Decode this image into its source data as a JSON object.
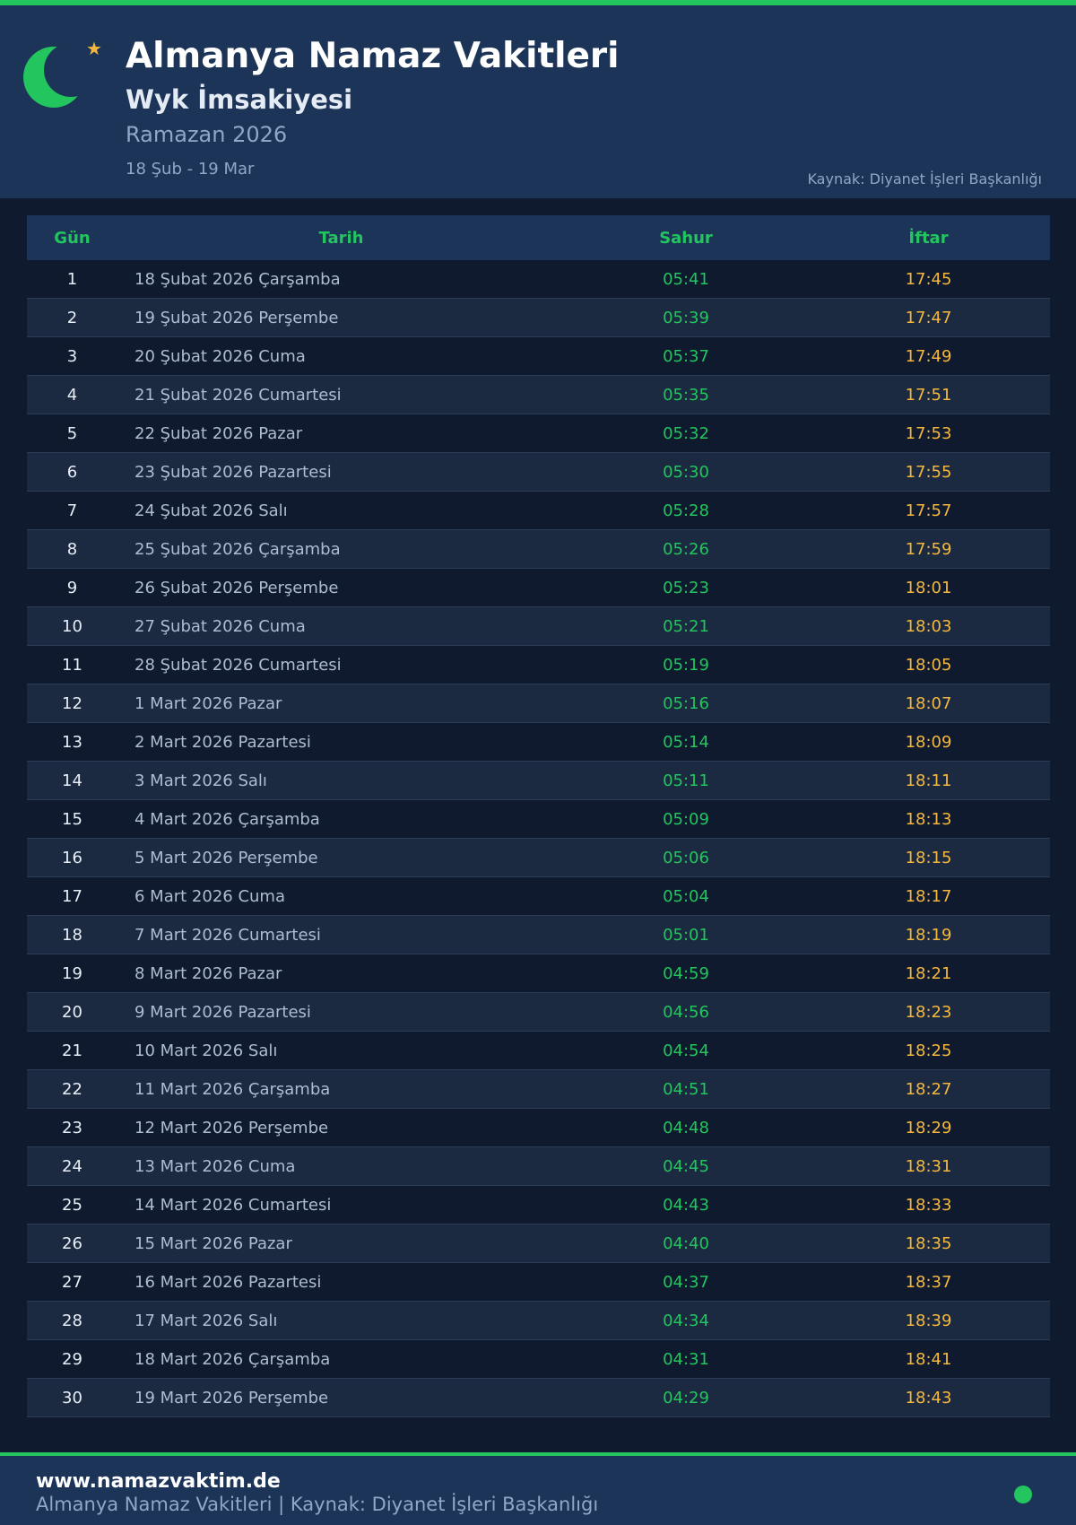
{
  "header": {
    "title": "Almanya Namaz Vakitleri",
    "subtitle": "Wyk İmsakiyesi",
    "ramazan": "Ramazan 2026",
    "date_range": "18 Şub - 19 Mar",
    "source": "Kaynak: Diyanet İşleri Başkanlığı",
    "icons": [
      "crescent-icon",
      "star-icon"
    ]
  },
  "colors": {
    "background": "#0f1a2e",
    "header": "#1c3457",
    "accent_green": "#22c55e",
    "accent_gold": "#f5b83d"
  },
  "table": {
    "columns": [
      "Gün",
      "Tarih",
      "Sahur",
      "İftar"
    ],
    "rows": [
      {
        "gun": "1",
        "tarih": "18 Şubat 2026 Çarşamba",
        "sahur": "05:41",
        "iftar": "17:45"
      },
      {
        "gun": "2",
        "tarih": "19 Şubat 2026 Perşembe",
        "sahur": "05:39",
        "iftar": "17:47"
      },
      {
        "gun": "3",
        "tarih": "20 Şubat 2026 Cuma",
        "sahur": "05:37",
        "iftar": "17:49"
      },
      {
        "gun": "4",
        "tarih": "21 Şubat 2026 Cumartesi",
        "sahur": "05:35",
        "iftar": "17:51"
      },
      {
        "gun": "5",
        "tarih": "22 Şubat 2026 Pazar",
        "sahur": "05:32",
        "iftar": "17:53"
      },
      {
        "gun": "6",
        "tarih": "23 Şubat 2026 Pazartesi",
        "sahur": "05:30",
        "iftar": "17:55"
      },
      {
        "gun": "7",
        "tarih": "24 Şubat 2026 Salı",
        "sahur": "05:28",
        "iftar": "17:57"
      },
      {
        "gun": "8",
        "tarih": "25 Şubat 2026 Çarşamba",
        "sahur": "05:26",
        "iftar": "17:59"
      },
      {
        "gun": "9",
        "tarih": "26 Şubat 2026 Perşembe",
        "sahur": "05:23",
        "iftar": "18:01"
      },
      {
        "gun": "10",
        "tarih": "27 Şubat 2026 Cuma",
        "sahur": "05:21",
        "iftar": "18:03"
      },
      {
        "gun": "11",
        "tarih": "28 Şubat 2026 Cumartesi",
        "sahur": "05:19",
        "iftar": "18:05"
      },
      {
        "gun": "12",
        "tarih": "1 Mart 2026 Pazar",
        "sahur": "05:16",
        "iftar": "18:07"
      },
      {
        "gun": "13",
        "tarih": "2 Mart 2026 Pazartesi",
        "sahur": "05:14",
        "iftar": "18:09"
      },
      {
        "gun": "14",
        "tarih": "3 Mart 2026 Salı",
        "sahur": "05:11",
        "iftar": "18:11"
      },
      {
        "gun": "15",
        "tarih": "4 Mart 2026 Çarşamba",
        "sahur": "05:09",
        "iftar": "18:13"
      },
      {
        "gun": "16",
        "tarih": "5 Mart 2026 Perşembe",
        "sahur": "05:06",
        "iftar": "18:15"
      },
      {
        "gun": "17",
        "tarih": "6 Mart 2026 Cuma",
        "sahur": "05:04",
        "iftar": "18:17"
      },
      {
        "gun": "18",
        "tarih": "7 Mart 2026 Cumartesi",
        "sahur": "05:01",
        "iftar": "18:19"
      },
      {
        "gun": "19",
        "tarih": "8 Mart 2026 Pazar",
        "sahur": "04:59",
        "iftar": "18:21"
      },
      {
        "gun": "20",
        "tarih": "9 Mart 2026 Pazartesi",
        "sahur": "04:56",
        "iftar": "18:23"
      },
      {
        "gun": "21",
        "tarih": "10 Mart 2026 Salı",
        "sahur": "04:54",
        "iftar": "18:25"
      },
      {
        "gun": "22",
        "tarih": "11 Mart 2026 Çarşamba",
        "sahur": "04:51",
        "iftar": "18:27"
      },
      {
        "gun": "23",
        "tarih": "12 Mart 2026 Perşembe",
        "sahur": "04:48",
        "iftar": "18:29"
      },
      {
        "gun": "24",
        "tarih": "13 Mart 2026 Cuma",
        "sahur": "04:45",
        "iftar": "18:31"
      },
      {
        "gun": "25",
        "tarih": "14 Mart 2026 Cumartesi",
        "sahur": "04:43",
        "iftar": "18:33"
      },
      {
        "gun": "26",
        "tarih": "15 Mart 2026 Pazar",
        "sahur": "04:40",
        "iftar": "18:35"
      },
      {
        "gun": "27",
        "tarih": "16 Mart 2026 Pazartesi",
        "sahur": "04:37",
        "iftar": "18:37"
      },
      {
        "gun": "28",
        "tarih": "17 Mart 2026 Salı",
        "sahur": "04:34",
        "iftar": "18:39"
      },
      {
        "gun": "29",
        "tarih": "18 Mart 2026 Çarşamba",
        "sahur": "04:31",
        "iftar": "18:41"
      },
      {
        "gun": "30",
        "tarih": "19 Mart 2026 Perşembe",
        "sahur": "04:29",
        "iftar": "18:43"
      }
    ]
  },
  "footer": {
    "site": "www.namazvaktim.de",
    "text": "Almanya Namaz Vakitleri | Kaynak: Diyanet İşleri Başkanlığı"
  }
}
